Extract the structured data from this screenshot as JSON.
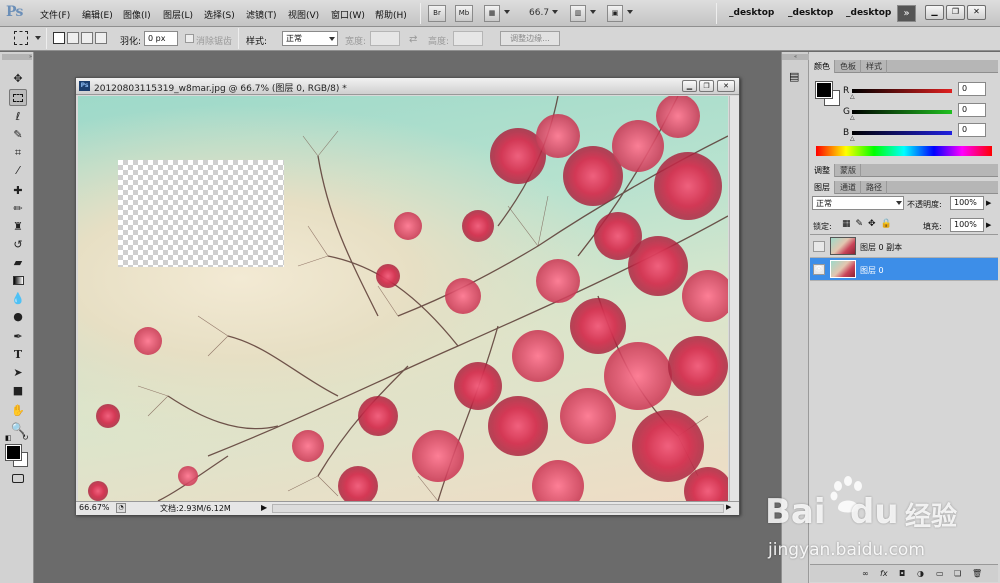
{
  "app": {
    "logo": "Ps"
  },
  "menu": [
    "文件(F)",
    "编辑(E)",
    "图像(I)",
    "图层(L)",
    "选择(S)",
    "滤镜(T)",
    "视图(V)",
    "窗口(W)",
    "帮助(H)"
  ],
  "appbar": {
    "bridge": "Br",
    "minibridge": "Mb",
    "zoom": "66.7"
  },
  "workspaces": [
    "_desktop",
    "_desktop",
    "_desktop"
  ],
  "options": {
    "feather_label": "羽化:",
    "feather_value": "0 px",
    "antialias_label": "消除锯齿",
    "style_label": "样式:",
    "style_value": "正常",
    "width_label": "宽度:",
    "height_label": "高度:",
    "refine_label": "调整边缘..."
  },
  "document": {
    "title": "20120803115319_w8mar.jpg @ 66.7% (图层 0, RGB/8) *",
    "zoom": "66.67%",
    "doc_size": "文档:2.93M/6.12M"
  },
  "color_panel": {
    "tabs": [
      "颜色",
      "色板",
      "样式"
    ],
    "channels": [
      {
        "label": "R",
        "value": "0",
        "color": "#e02020"
      },
      {
        "label": "G",
        "value": "0",
        "color": "#20c020"
      },
      {
        "label": "B",
        "value": "0",
        "color": "#2020e0"
      }
    ]
  },
  "adjust_panel": {
    "tabs": [
      "调整",
      "蒙版"
    ]
  },
  "layers_panel": {
    "tabs": [
      "图层",
      "通道",
      "路径"
    ],
    "blend_mode": "正常",
    "opacity_label": "不透明度:",
    "opacity_value": "100%",
    "lock_label": "锁定:",
    "fill_label": "填充:",
    "fill_value": "100%",
    "layers": [
      {
        "name": "图层 0 副本",
        "visible": false,
        "selected": false
      },
      {
        "name": "图层 0",
        "visible": true,
        "selected": true
      }
    ]
  },
  "watermark": {
    "brand": "Bai",
    "brand2": "du",
    "cn": "经验",
    "url": "jingyan.baidu.com"
  }
}
